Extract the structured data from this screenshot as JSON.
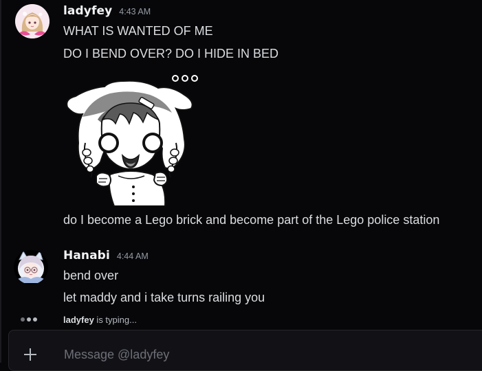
{
  "messages": [
    {
      "username": "ladyfey",
      "timestamp": "4:43 AM",
      "avatar_icon": "avatar-ladyfey-icon",
      "lines": [
        "WHAT IS WANTED OF ME",
        "DO I BEND OVER? DO I HIDE IN BED"
      ],
      "sticker": "confused-chibi-girl-sticker",
      "after_sticker": "do I become a Lego brick and become part of the Lego police station"
    },
    {
      "username": "Hanabi",
      "timestamp": "4:44 AM",
      "avatar_icon": "avatar-hanabi-icon",
      "lines": [
        "bend over",
        "let maddy and i take turns railing you"
      ]
    }
  ],
  "typing": {
    "name": "ladyfey",
    "text": " is typing..."
  },
  "composer": {
    "placeholder": "Message @ladyfey",
    "value": ""
  },
  "colors": {
    "background": "#070709",
    "text": "#dbdee1",
    "muted": "#949ba4",
    "username": "#f2f3f5",
    "composer_bg": "#121216"
  }
}
